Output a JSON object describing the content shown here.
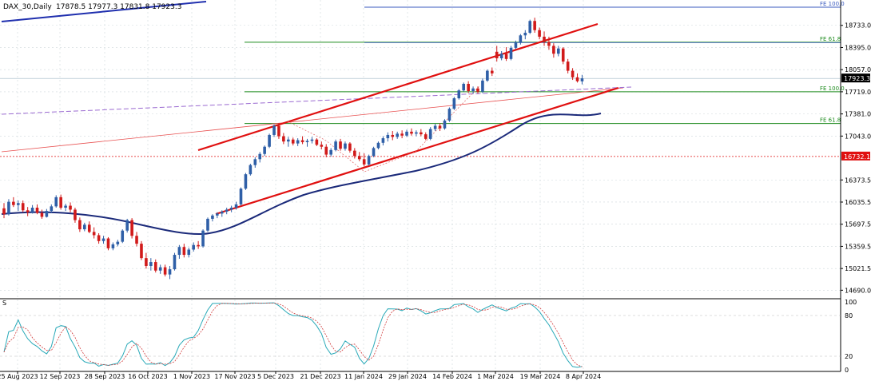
{
  "header": {
    "symbol_label": "DAX_30,Daily",
    "ohlc_label": "17878.5 17977.3 17831.8 17923.3"
  },
  "oscillator": {
    "label": "S",
    "levels": [
      "100",
      "80",
      "20",
      "0"
    ]
  },
  "colors": {
    "up_candle": "#2f5fa7",
    "down_candle": "#d11a1a",
    "ma": "#1b2a7a",
    "channel": "#e01010",
    "fib_green": "#1b8a1b",
    "fib_blue": "#3b5bbf",
    "osc_k": "#29a9b8",
    "osc_d": "#d13a3a",
    "grid": "#cfd8dc"
  },
  "chart_data": {
    "type": "candlestick",
    "title": "DAX_30,Daily",
    "ohlc_last": {
      "open": 17878.5,
      "high": 17977.3,
      "low": 17831.8,
      "close": 17923.3
    },
    "y_tick_labels": [
      "18733.0",
      "18395.0",
      "18057.0",
      "17719.0",
      "17381.0",
      "17043.0",
      "16373.5",
      "16035.5",
      "15697.5",
      "15359.5",
      "15021.5",
      "14690.0"
    ],
    "x_tick_labels": [
      "25 Aug 2023",
      "12 Sep 2023",
      "28 Sep 2023",
      "16 Oct 2023",
      "1 Nov 2023",
      "17 Nov 2023",
      "5 Dec 2023",
      "21 Dec 2023",
      "11 Jan 2024",
      "29 Jan 2024",
      "14 Feb 2024",
      "1 Mar 2024",
      "19 Mar 2024",
      "8 Apr 2024"
    ],
    "ylim": [
      14560,
      19120
    ],
    "price_labels": [
      {
        "text": "17923.3",
        "value": 17923.3,
        "style": "current"
      },
      {
        "text": "16732.1",
        "value": 16732.1,
        "style": "red"
      }
    ],
    "fib_levels": [
      {
        "text": "FE 100.0",
        "value": 19010
      },
      {
        "text": "FE 61.8",
        "value": 18475
      },
      {
        "text": "FE 100.0",
        "value": 17719
      },
      {
        "text": "FE 61.8",
        "value": 17235
      }
    ],
    "candles": [
      {
        "o": 15940,
        "h": 16020,
        "l": 15790,
        "c": 15850
      },
      {
        "o": 15850,
        "h": 16080,
        "l": 15830,
        "c": 16040
      },
      {
        "o": 16040,
        "h": 16110,
        "l": 15960,
        "c": 15990
      },
      {
        "o": 15990,
        "h": 16060,
        "l": 15900,
        "c": 16020
      },
      {
        "o": 16020,
        "h": 16060,
        "l": 15880,
        "c": 15910
      },
      {
        "o": 15910,
        "h": 15960,
        "l": 15820,
        "c": 15880
      },
      {
        "o": 15880,
        "h": 15990,
        "l": 15860,
        "c": 15950
      },
      {
        "o": 15950,
        "h": 16000,
        "l": 15850,
        "c": 15870
      },
      {
        "o": 15870,
        "h": 15920,
        "l": 15780,
        "c": 15810
      },
      {
        "o": 15810,
        "h": 15930,
        "l": 15800,
        "c": 15900
      },
      {
        "o": 15900,
        "h": 16000,
        "l": 15870,
        "c": 15970
      },
      {
        "o": 15970,
        "h": 16140,
        "l": 15950,
        "c": 16110
      },
      {
        "o": 16110,
        "h": 16150,
        "l": 15920,
        "c": 15950
      },
      {
        "o": 15950,
        "h": 16010,
        "l": 15900,
        "c": 15980
      },
      {
        "o": 15980,
        "h": 16030,
        "l": 15880,
        "c": 15920
      },
      {
        "o": 15920,
        "h": 15950,
        "l": 15720,
        "c": 15760
      },
      {
        "o": 15760,
        "h": 15800,
        "l": 15580,
        "c": 15620
      },
      {
        "o": 15620,
        "h": 15720,
        "l": 15590,
        "c": 15690
      },
      {
        "o": 15690,
        "h": 15740,
        "l": 15560,
        "c": 15580
      },
      {
        "o": 15580,
        "h": 15650,
        "l": 15480,
        "c": 15530
      },
      {
        "o": 15530,
        "h": 15560,
        "l": 15400,
        "c": 15440
      },
      {
        "o": 15440,
        "h": 15520,
        "l": 15400,
        "c": 15480
      },
      {
        "o": 15480,
        "h": 15500,
        "l": 15300,
        "c": 15330
      },
      {
        "o": 15330,
        "h": 15420,
        "l": 15300,
        "c": 15390
      },
      {
        "o": 15390,
        "h": 15460,
        "l": 15360,
        "c": 15430
      },
      {
        "o": 15430,
        "h": 15620,
        "l": 15410,
        "c": 15600
      },
      {
        "o": 15600,
        "h": 15780,
        "l": 15570,
        "c": 15760
      },
      {
        "o": 15760,
        "h": 15790,
        "l": 15480,
        "c": 15520
      },
      {
        "o": 15520,
        "h": 15580,
        "l": 15360,
        "c": 15400
      },
      {
        "o": 15400,
        "h": 15440,
        "l": 15150,
        "c": 15180
      },
      {
        "o": 15180,
        "h": 15260,
        "l": 15020,
        "c": 15060
      },
      {
        "o": 15060,
        "h": 15180,
        "l": 14990,
        "c": 15120
      },
      {
        "o": 15120,
        "h": 15160,
        "l": 14960,
        "c": 14990
      },
      {
        "o": 14990,
        "h": 15080,
        "l": 14940,
        "c": 15040
      },
      {
        "o": 15040,
        "h": 15080,
        "l": 14900,
        "c": 14930
      },
      {
        "o": 14930,
        "h": 15060,
        "l": 14860,
        "c": 15010
      },
      {
        "o": 15010,
        "h": 15260,
        "l": 14990,
        "c": 15230
      },
      {
        "o": 15230,
        "h": 15380,
        "l": 15170,
        "c": 15350
      },
      {
        "o": 15350,
        "h": 15400,
        "l": 15190,
        "c": 15230
      },
      {
        "o": 15230,
        "h": 15340,
        "l": 15190,
        "c": 15310
      },
      {
        "o": 15310,
        "h": 15420,
        "l": 15280,
        "c": 15380
      },
      {
        "o": 15380,
        "h": 15440,
        "l": 15320,
        "c": 15360
      },
      {
        "o": 15360,
        "h": 15620,
        "l": 15340,
        "c": 15600
      },
      {
        "o": 15600,
        "h": 15800,
        "l": 15580,
        "c": 15780
      },
      {
        "o": 15780,
        "h": 15850,
        "l": 15740,
        "c": 15830
      },
      {
        "o": 15830,
        "h": 15880,
        "l": 15790,
        "c": 15860
      },
      {
        "o": 15860,
        "h": 15910,
        "l": 15810,
        "c": 15890
      },
      {
        "o": 15890,
        "h": 15950,
        "l": 15850,
        "c": 15920
      },
      {
        "o": 15920,
        "h": 15980,
        "l": 15880,
        "c": 15950
      },
      {
        "o": 15950,
        "h": 16040,
        "l": 15920,
        "c": 16000
      },
      {
        "o": 16000,
        "h": 16260,
        "l": 15980,
        "c": 16240
      },
      {
        "o": 16240,
        "h": 16480,
        "l": 16220,
        "c": 16460
      },
      {
        "o": 16460,
        "h": 16620,
        "l": 16440,
        "c": 16600
      },
      {
        "o": 16600,
        "h": 16720,
        "l": 16560,
        "c": 16690
      },
      {
        "o": 16690,
        "h": 16800,
        "l": 16640,
        "c": 16770
      },
      {
        "o": 16770,
        "h": 16900,
        "l": 16740,
        "c": 16880
      },
      {
        "o": 16880,
        "h": 17080,
        "l": 16860,
        "c": 17060
      },
      {
        "o": 17060,
        "h": 17220,
        "l": 17030,
        "c": 17200
      },
      {
        "o": 17200,
        "h": 17240,
        "l": 17000,
        "c": 17040
      },
      {
        "o": 17040,
        "h": 17090,
        "l": 16920,
        "c": 16960
      },
      {
        "o": 16960,
        "h": 17030,
        "l": 16880,
        "c": 16990
      },
      {
        "o": 16990,
        "h": 17020,
        "l": 16900,
        "c": 16930
      },
      {
        "o": 16930,
        "h": 17010,
        "l": 16890,
        "c": 16980
      },
      {
        "o": 16980,
        "h": 17040,
        "l": 16920,
        "c": 16950
      },
      {
        "o": 16950,
        "h": 17000,
        "l": 16880,
        "c": 16970
      },
      {
        "o": 16970,
        "h": 17030,
        "l": 16930,
        "c": 16990
      },
      {
        "o": 16990,
        "h": 17010,
        "l": 16890,
        "c": 16910
      },
      {
        "o": 16910,
        "h": 16960,
        "l": 16840,
        "c": 16880
      },
      {
        "o": 16880,
        "h": 16920,
        "l": 16720,
        "c": 16760
      },
      {
        "o": 16760,
        "h": 16860,
        "l": 16730,
        "c": 16830
      },
      {
        "o": 16830,
        "h": 16990,
        "l": 16810,
        "c": 16960
      },
      {
        "o": 16960,
        "h": 17000,
        "l": 16820,
        "c": 16850
      },
      {
        "o": 16850,
        "h": 16960,
        "l": 16820,
        "c": 16930
      },
      {
        "o": 16930,
        "h": 16950,
        "l": 16790,
        "c": 16820
      },
      {
        "o": 16820,
        "h": 16860,
        "l": 16700,
        "c": 16740
      },
      {
        "o": 16740,
        "h": 16800,
        "l": 16660,
        "c": 16690
      },
      {
        "o": 16690,
        "h": 16780,
        "l": 16580,
        "c": 16610
      },
      {
        "o": 16610,
        "h": 16760,
        "l": 16590,
        "c": 16740
      },
      {
        "o": 16740,
        "h": 16880,
        "l": 16720,
        "c": 16860
      },
      {
        "o": 16860,
        "h": 16960,
        "l": 16840,
        "c": 16940
      },
      {
        "o": 16940,
        "h": 17040,
        "l": 16900,
        "c": 17010
      },
      {
        "o": 17010,
        "h": 17100,
        "l": 16960,
        "c": 17060
      },
      {
        "o": 17060,
        "h": 17120,
        "l": 16980,
        "c": 17030
      },
      {
        "o": 17030,
        "h": 17110,
        "l": 17000,
        "c": 17080
      },
      {
        "o": 17080,
        "h": 17130,
        "l": 17010,
        "c": 17050
      },
      {
        "o": 17050,
        "h": 17140,
        "l": 17030,
        "c": 17110
      },
      {
        "o": 17110,
        "h": 17160,
        "l": 17050,
        "c": 17080
      },
      {
        "o": 17080,
        "h": 17130,
        "l": 17040,
        "c": 17100
      },
      {
        "o": 17100,
        "h": 17150,
        "l": 17040,
        "c": 17070
      },
      {
        "o": 17070,
        "h": 17100,
        "l": 16980,
        "c": 17000
      },
      {
        "o": 17000,
        "h": 17180,
        "l": 16980,
        "c": 17150
      },
      {
        "o": 17150,
        "h": 17230,
        "l": 17120,
        "c": 17200
      },
      {
        "o": 17200,
        "h": 17240,
        "l": 17120,
        "c": 17160
      },
      {
        "o": 17160,
        "h": 17300,
        "l": 17140,
        "c": 17280
      },
      {
        "o": 17280,
        "h": 17480,
        "l": 17260,
        "c": 17460
      },
      {
        "o": 17460,
        "h": 17640,
        "l": 17440,
        "c": 17620
      },
      {
        "o": 17620,
        "h": 17760,
        "l": 17600,
        "c": 17740
      },
      {
        "o": 17740,
        "h": 17860,
        "l": 17720,
        "c": 17840
      },
      {
        "o": 17840,
        "h": 17880,
        "l": 17700,
        "c": 17730
      },
      {
        "o": 17730,
        "h": 17800,
        "l": 17690,
        "c": 17770
      },
      {
        "o": 17770,
        "h": 17800,
        "l": 17690,
        "c": 17720
      },
      {
        "o": 17720,
        "h": 17920,
        "l": 17700,
        "c": 17890
      },
      {
        "o": 17890,
        "h": 18060,
        "l": 17870,
        "c": 18040
      },
      {
        "o": 18040,
        "h": 18090,
        "l": 17960,
        "c": 18000
      },
      {
        "o": 18330,
        "h": 18420,
        "l": 18180,
        "c": 18230
      },
      {
        "o": 18230,
        "h": 18340,
        "l": 18200,
        "c": 18300
      },
      {
        "o": 18300,
        "h": 18400,
        "l": 18190,
        "c": 18220
      },
      {
        "o": 18220,
        "h": 18420,
        "l": 18200,
        "c": 18390
      },
      {
        "o": 18390,
        "h": 18500,
        "l": 18370,
        "c": 18470
      },
      {
        "o": 18470,
        "h": 18600,
        "l": 18440,
        "c": 18580
      },
      {
        "o": 18580,
        "h": 18660,
        "l": 18520,
        "c": 18620
      },
      {
        "o": 18620,
        "h": 18820,
        "l": 18600,
        "c": 18800
      },
      {
        "o": 18800,
        "h": 18850,
        "l": 18620,
        "c": 18660
      },
      {
        "o": 18660,
        "h": 18700,
        "l": 18520,
        "c": 18560
      },
      {
        "o": 18560,
        "h": 18640,
        "l": 18420,
        "c": 18480
      },
      {
        "o": 18480,
        "h": 18560,
        "l": 18360,
        "c": 18420
      },
      {
        "o": 18420,
        "h": 18460,
        "l": 18240,
        "c": 18300
      },
      {
        "o": 18300,
        "h": 18420,
        "l": 18260,
        "c": 18380
      },
      {
        "o": 18380,
        "h": 18400,
        "l": 18140,
        "c": 18180
      },
      {
        "o": 18180,
        "h": 18220,
        "l": 18000,
        "c": 18040
      },
      {
        "o": 18040,
        "h": 18080,
        "l": 17900,
        "c": 17940
      },
      {
        "o": 17940,
        "h": 18000,
        "l": 17860,
        "c": 17880
      },
      {
        "o": 17878.5,
        "h": 17977.3,
        "l": 17831.8,
        "c": 17923.3
      }
    ]
  }
}
